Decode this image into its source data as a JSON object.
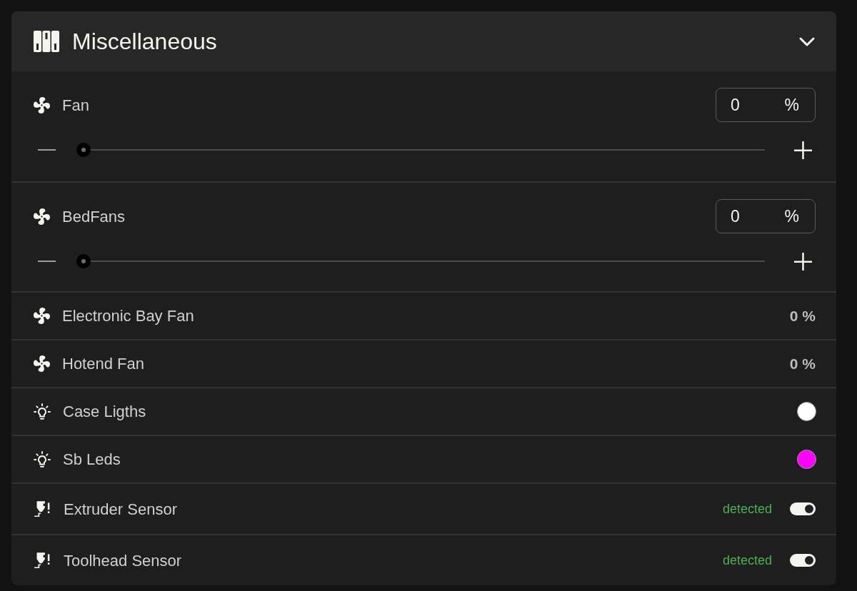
{
  "panel": {
    "title": "Miscellaneous"
  },
  "items": [
    {
      "kind": "slider",
      "name": "Fan",
      "value": "0",
      "unit": "%",
      "level": 0
    },
    {
      "kind": "slider",
      "name": "BedFans",
      "value": "0",
      "unit": "%",
      "level": 0
    },
    {
      "kind": "readout",
      "name": "Electronic Bay Fan",
      "reading": "0 %"
    },
    {
      "kind": "readout",
      "name": "Hotend Fan",
      "reading": "0 %"
    },
    {
      "kind": "light",
      "name": "Case Ligths",
      "color": "#ffffff"
    },
    {
      "kind": "light",
      "name": "Sb Leds",
      "color": "#ff00ff"
    },
    {
      "kind": "sensor",
      "name": "Extruder Sensor",
      "status": "detected",
      "on": true
    },
    {
      "kind": "sensor",
      "name": "Toolhead Sensor",
      "status": "detected",
      "on": true
    }
  ]
}
